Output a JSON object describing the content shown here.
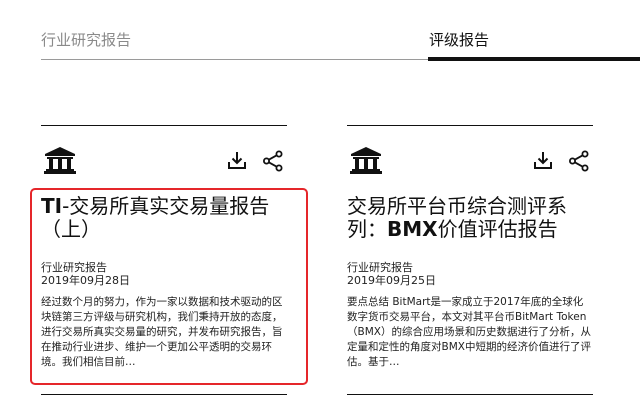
{
  "tabs": [
    {
      "label": "行业研究报告",
      "active": false
    },
    {
      "label": "评级报告",
      "active": true
    }
  ],
  "cards": [
    {
      "title_bold": "TI",
      "title_rest": "-交易所真实交易量报告（上）",
      "category": "行业研究报告",
      "date": "2019年09月28日",
      "summary": "经过数个月的努力，作为一家以数据和技术驱动的区块链第三方评级与研究机构，我们秉持开放的态度，进行交易所真实交易量的研究，并发布研究报告，旨在推动行业进步、维护一个更加公平透明的交易环境。我们相信目前…",
      "icons": {
        "category": "bank-icon",
        "download": "download-icon",
        "share": "share-icon"
      }
    },
    {
      "title_part1": "交易所平台币综合测评系列：",
      "title_bold": "BMX",
      "title_part2": "价值评估报告",
      "category": "行业研究报告",
      "date": "2019年09月25日",
      "summary": "要点总结 BitMart是一家成立于2017年底的全球化数字货币交易平台，本文对其平台币BitMart Token（BMX）的综合应用场景和历史数据进行了分析，从定量和定性的角度对BMX中短期的经济价值进行了评估。基于…",
      "icons": {
        "category": "bank-icon",
        "download": "download-icon",
        "share": "share-icon"
      }
    }
  ],
  "colors": {
    "highlight": "#e5262a",
    "inactive_tab": "#8a8a8a",
    "text": "#111111"
  }
}
